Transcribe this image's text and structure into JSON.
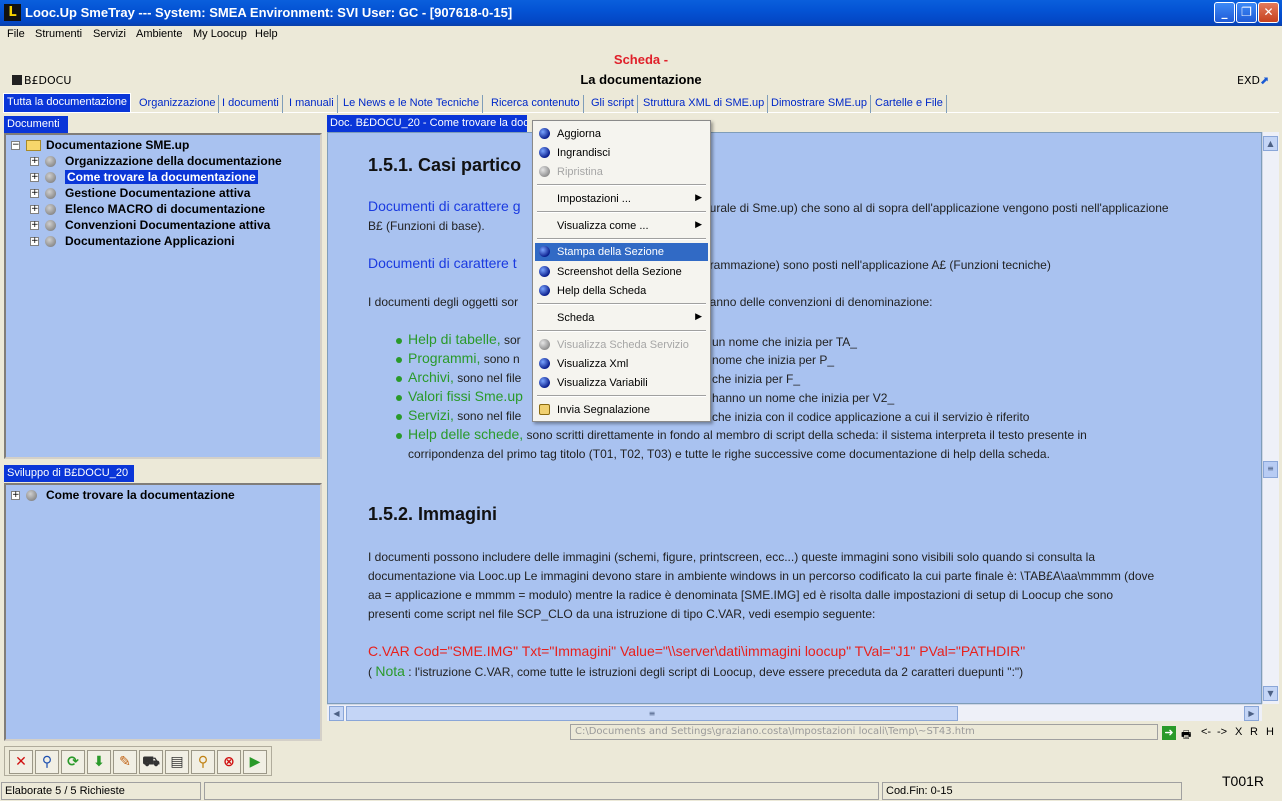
{
  "window": {
    "title": "Looc.Up SmeTray --- System: SMEA Environment: SVI User: GC - [907618-0-15]",
    "app_icon": "L"
  },
  "menu": [
    "File",
    "Strumenti",
    "Servizi",
    "Ambiente",
    "My Loocup",
    "Help"
  ],
  "header": {
    "scheda": "Scheda -",
    "title": "La documentazione",
    "code": "B£DOCU",
    "exd": "EXD"
  },
  "tabs": [
    "Tutta la documentazione",
    "Organizzazione",
    "I documenti",
    "I manuali",
    "Le News e le Note Tecniche",
    "Ricerca contenuto",
    "Gli script",
    "Struttura XML di SME.up",
    "Dimostrare SME.up",
    "Cartelle e File"
  ],
  "left_top": {
    "header": "Documenti",
    "root": "Documentazione SME.up",
    "nodes": [
      "Organizzazione della documentazione",
      "Come trovare la documentazione",
      "Gestione Documentazione attiva",
      "Elenco MACRO di documentazione",
      "Convenzioni Documentazione attiva",
      "Documentazione Applicazioni"
    ],
    "selected_index": 1
  },
  "left_bottom": {
    "header": "Sviluppo di B£DOCU_20",
    "node": "Come trovare la documentazione"
  },
  "doc": {
    "tab_header": "Doc. B£DOCU_20 - Come trovare la documentazione",
    "h1": "1.5.1.  Casi partico",
    "p1_a": "Documenti di carattere g",
    "p1_b": "tturale di Sme.up) che sono al di sopra dell'applicazione vengono posti nell'applicazione",
    "p1_c": "B£ (Funzioni di base).",
    "p2_a": "Documenti di carattere t",
    "p2_b": "grammazione) sono posti nell'applicazione A£ (Funzioni tecniche)",
    "p3_a": "I documenti degli oggetti sor",
    "p3_b": "hanno delle convenzioni di denominazione:",
    "bullets": [
      {
        "g": "Help di tabelle,",
        "a": " sor",
        "b": " un nome che inizia per TA_"
      },
      {
        "g": "Programmi,",
        "a": " sono n",
        "b": "nome che inizia per P_"
      },
      {
        "g": "Archivi,",
        "a": " sono nel file",
        "b": " che inizia per F_"
      },
      {
        "g": "Valori fissi Sme.up",
        "a": "",
        "b": "hanno un nome che inizia per V2_"
      },
      {
        "g": "Servizi,",
        "a": " sono nel file",
        "b": "che inizia con il codice applicazione a cui il servizio è riferito"
      }
    ],
    "bullet6_g": "Help delle schede,",
    "bullet6_t": " sono scritti direttamente in fondo al membro di script della scheda: il sistema interpreta il testo presente in",
    "bullet6_t2": "corripondenza del primo tag titolo (T01, T02, T03) e tutte le righe successive come documentazione di help della scheda.",
    "h2": "1.5.2.  Immagini",
    "img_p1": "I documenti possono includere delle immagini (schemi, figure, printscreen, ecc...) queste immagini sono visibili solo quando si consulta la",
    "img_p2": "documentazione via Looc.up Le immagini devono stare in ambiente windows in un percorso codificato la cui parte finale è: \\TAB£A\\aa\\mmmm (dove",
    "img_p3": "aa = applicazione e mmmm = modulo) mentre la radice è denominata [SME.IMG] ed è risolta dalle impostazioni di setup di Loocup che sono",
    "img_p4": "presenti come script nel file SCP_CLO da una istruzione di tipo C.VAR, vedi esempio seguente:",
    "cvar": "C.VAR Cod=\"SME.IMG\" Txt=\"Immagini\" Value=\"\\\\server\\dati\\immagini loocup\" TVal=\"J1\" PVal=\"PATHDIR\"",
    "nota_open": "( ",
    "nota_label": "Nota",
    "nota_text": " : l'istruzione C.VAR, come tutte le istruzioni degli script di Loocup, deve essere preceduta da 2 caratteri duepunti \":\")"
  },
  "context_menu": {
    "items": [
      {
        "label": "Aggiorna",
        "icon": "blue-orb-icon"
      },
      {
        "label": "Ingrandisci",
        "icon": "blue-orb-icon"
      },
      {
        "label": "Ripristina",
        "icon": "gray-orb-icon",
        "disabled": true
      },
      {
        "label": "Impostazioni ...",
        "submenu": true
      },
      {
        "label": "Visualizza come ...",
        "submenu": true
      },
      {
        "label": "Stampa della Sezione",
        "icon": "blue-orb-icon",
        "highlighted": true
      },
      {
        "label": "Screenshot della Sezione",
        "icon": "blue-orb-icon"
      },
      {
        "label": "Help della Scheda",
        "icon": "blue-orb-icon"
      },
      {
        "label": "Scheda",
        "submenu": true
      },
      {
        "label": "Visualizza Scheda Servizio",
        "icon": "gray-orb-icon",
        "disabled": true
      },
      {
        "label": "Visualizza Xml",
        "icon": "blue-orb-icon"
      },
      {
        "label": "Visualizza Variabili",
        "icon": "blue-orb-icon"
      },
      {
        "label": "Invia Segnalazione",
        "icon": "mail-icon"
      }
    ]
  },
  "bottom": {
    "path": "C:\\Documents and Settings\\graziano.costa\\Impostazioni locali\\Temp\\~ST43.htm",
    "nav": [
      "<-",
      "->",
      "X",
      "R",
      "H"
    ],
    "toolbar_icons": [
      "close-red-x-icon",
      "search-icon",
      "refresh-icon",
      "download-icon",
      "edit-icon",
      "cart-icon",
      "document-icon",
      "magnify-icon",
      "stop-icon",
      "play-icon"
    ],
    "status_left": "Elaborate 5 / 5 Richieste",
    "status_codfin": "Cod.Fin: 0-15",
    "tcode": "T001R"
  },
  "colors": {
    "titlebar": "#0453d4",
    "tab_active": "#0a36d8",
    "panel_bg": "#a9c2f0",
    "doc_blue": "#1a3ae0",
    "doc_green": "#2a9a2a",
    "doc_red": "#e8201c",
    "scheda_red": "#e0202a"
  }
}
